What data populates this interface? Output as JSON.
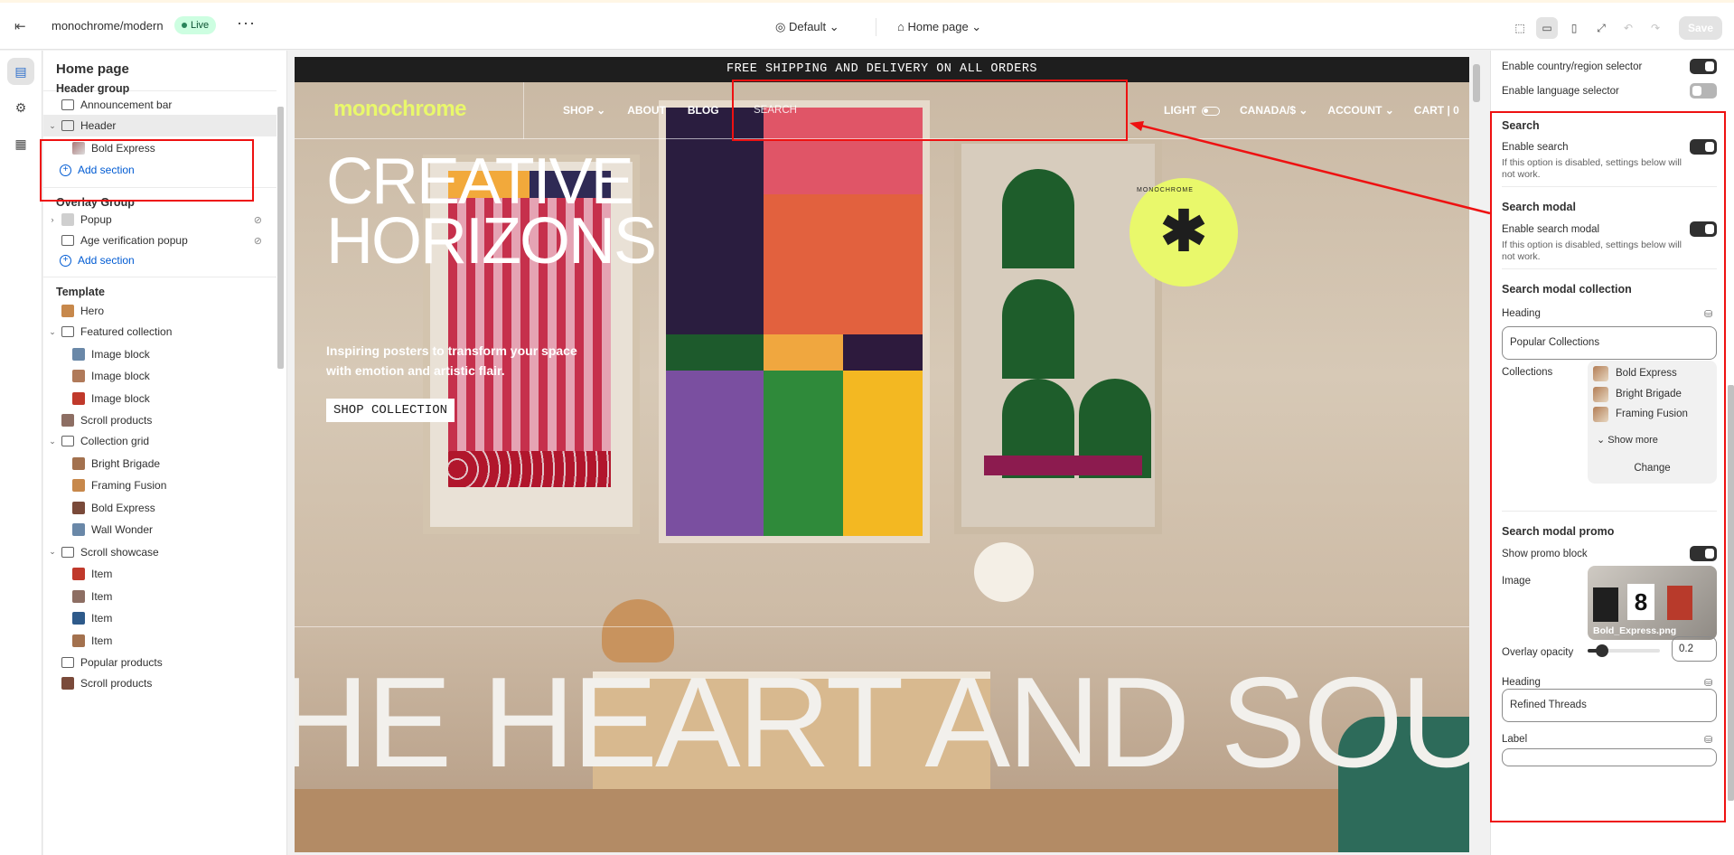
{
  "topbar": {
    "store": "monochrome/modern",
    "status": "Live",
    "theme": "Default",
    "page": "Home page",
    "save": "Save"
  },
  "left": {
    "title": "Home page",
    "header_group": "Header group",
    "announcement": "Announcement bar",
    "header": "Header",
    "bold_express": "Bold Express",
    "add_section": "Add section",
    "overlay_group": "Overlay Group",
    "popup": "Popup",
    "age_popup": "Age verification popup",
    "template": "Template",
    "items": [
      {
        "label": "Hero",
        "kind": "thumb"
      },
      {
        "label": "Featured collection",
        "kind": "section"
      },
      {
        "label": "Image block",
        "kind": "block"
      },
      {
        "label": "Image block",
        "kind": "block"
      },
      {
        "label": "Image block",
        "kind": "block"
      },
      {
        "label": "Scroll products",
        "kind": "thumb"
      },
      {
        "label": "Collection grid",
        "kind": "section"
      },
      {
        "label": "Bright Brigade",
        "kind": "block"
      },
      {
        "label": "Framing Fusion",
        "kind": "block"
      },
      {
        "label": "Bold Express",
        "kind": "block"
      },
      {
        "label": "Wall Wonder",
        "kind": "block"
      },
      {
        "label": "Scroll showcase",
        "kind": "section"
      },
      {
        "label": "Item",
        "kind": "block"
      },
      {
        "label": "Item",
        "kind": "block"
      },
      {
        "label": "Item",
        "kind": "block"
      },
      {
        "label": "Item",
        "kind": "block"
      },
      {
        "label": "Popular products",
        "kind": "plain"
      },
      {
        "label": "Scroll products",
        "kind": "thumb"
      }
    ]
  },
  "preview": {
    "announcement": "FREE SHIPPING AND DELIVERY ON ALL ORDERS",
    "logo": "monochrome",
    "nav": [
      "SHOP",
      "ABOUT",
      "BLOG"
    ],
    "search": "SEARCH",
    "light": "LIGHT",
    "currency": "CANADA/$",
    "account": "ACCOUNT",
    "cart": "CART | 0",
    "hero_line1": "CREATIVE",
    "hero_line2": "HORIZONS",
    "hero_sub": "Inspiring posters to transform your space with emotion and artistic flair.",
    "hero_button": "SHOP COLLECTION",
    "badge_text": "MONOCHROME",
    "marquee": "HE HEART AND SOU"
  },
  "right": {
    "country_selector": "Enable country/region selector",
    "language_selector": "Enable language selector",
    "search_head": "Search",
    "enable_search": "Enable search",
    "help1": "If this option is disabled, settings below will not work.",
    "modal_head": "Search modal",
    "enable_modal": "Enable search modal",
    "help2": "If this option is disabled, settings below will not work.",
    "collection_head": "Search modal collection",
    "heading_label": "Heading",
    "heading_value": "Popular Collections",
    "collections_label": "Collections",
    "collections": [
      "Bold Express",
      "Bright Brigade",
      "Framing Fusion"
    ],
    "show_more": "Show more",
    "change": "Change",
    "promo_head": "Search modal promo",
    "show_promo": "Show promo block",
    "image_label": "Image",
    "image_name": "Bold_Express.png",
    "overlay_label": "Overlay opacity",
    "overlay_value": "0.2",
    "overlay_fraction": 0.2,
    "heading2_label": "Heading",
    "heading2_value": "Refined Threads",
    "label_label": "Label"
  },
  "colors": {
    "highlight": "#e11111",
    "logo": "#e9f86b",
    "live_bg": "#cdfee1"
  }
}
